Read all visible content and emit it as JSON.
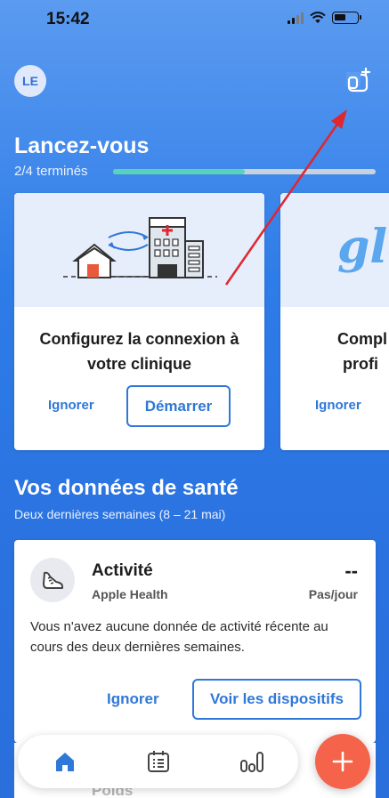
{
  "status_bar": {
    "time": "15:42"
  },
  "header": {
    "avatar_initials": "LE",
    "add_device_icon": "add-device-icon"
  },
  "launch": {
    "title": "Lancez-vous",
    "progress_text": "2/4 terminés",
    "progress_fraction": 0.5,
    "cards": [
      {
        "title_line1": "Configurez la connexion à",
        "title_line2": "votre clinique",
        "skip_label": "Ignorer",
        "start_label": "Démarrer"
      },
      {
        "illustration_text": "glo",
        "title_line1": "Compl",
        "title_line2": "profi",
        "skip_label": "Ignorer"
      }
    ]
  },
  "health": {
    "title": "Vos données de santé",
    "subtitle": "Deux dernières semaines (8 – 21 mai)",
    "activity": {
      "title": "Activité",
      "source": "Apple Health",
      "value": "--",
      "unit": "Pas/jour",
      "message": "Vous n'avez aucune donnée de activité récente au cours des deux dernières semaines.",
      "skip_label": "Ignorer",
      "devices_label": "Voir les dispositifs"
    },
    "next_item_label": "Poids"
  },
  "colors": {
    "accent": "#2f78d8",
    "progress": "#59d2b7",
    "fab": "#f4634a",
    "annotation_arrow": "#e0262f"
  },
  "tabs": [
    "home-icon",
    "calendar-list-icon",
    "chart-icon"
  ]
}
